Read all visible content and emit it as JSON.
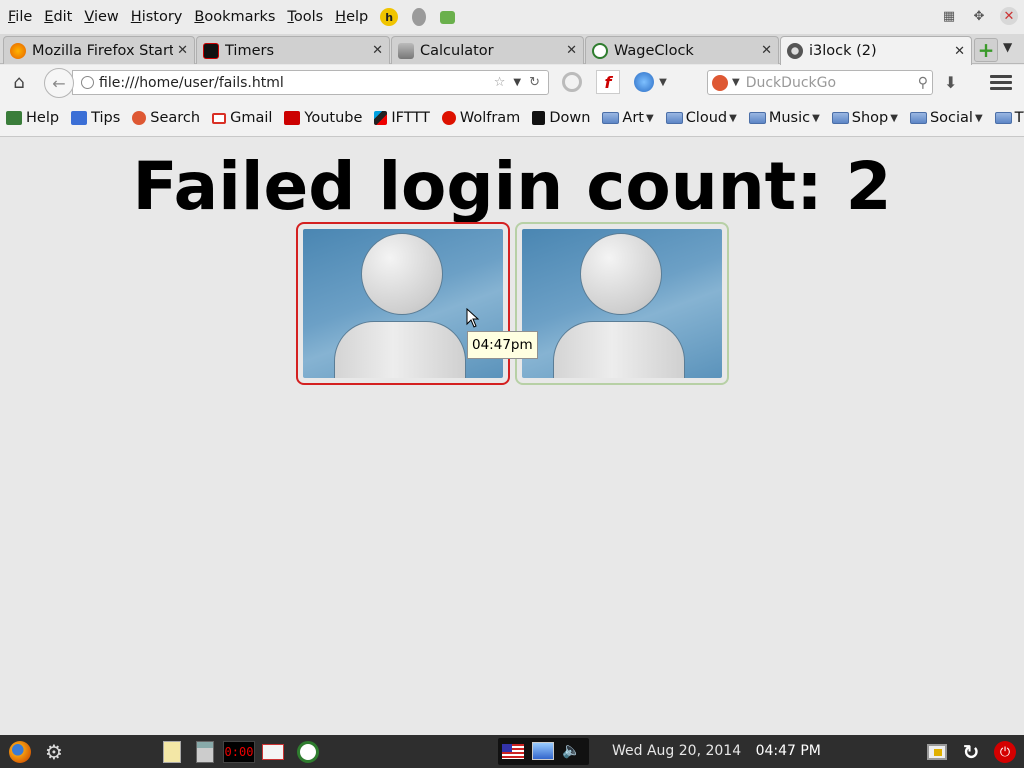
{
  "menubar": {
    "items": [
      "File",
      "Edit",
      "View",
      "History",
      "Bookmarks",
      "Tools",
      "Help"
    ]
  },
  "tabs": [
    {
      "label": "Mozilla Firefox Start ...",
      "close": "✕",
      "icon": "firefox-icon",
      "color": "#e66000"
    },
    {
      "label": "Timers",
      "close": "✕",
      "icon": "timer-icon",
      "color": "#cc0000"
    },
    {
      "label": "Calculator",
      "close": "✕",
      "icon": "calculator-icon",
      "color": "#7a7a7a"
    },
    {
      "label": "WageClock",
      "close": "✕",
      "icon": "wageclock-icon",
      "color": "#2f7d2f"
    },
    {
      "label": "i3lock (2)",
      "close": "✕",
      "icon": "i3lock-icon",
      "color": "#555555"
    }
  ],
  "navbar": {
    "url": "file:///home/user/fails.html",
    "search_placeholder": "DuckDuckGo"
  },
  "bookmarks": [
    {
      "label": "Help",
      "icon": "help-icon",
      "color": "#3a7d3a"
    },
    {
      "label": "Tips",
      "icon": "tips-icon",
      "color": "#3b6fd6"
    },
    {
      "label": "Search",
      "icon": "duckduckgo-icon",
      "color": "#de5833"
    },
    {
      "label": "Gmail",
      "icon": "gmail-icon",
      "color": "#d93025"
    },
    {
      "label": "Youtube",
      "icon": "youtube-icon",
      "color": "#cc0000"
    },
    {
      "label": "IFTTT",
      "icon": "ifttt-icon",
      "color": "#222222"
    },
    {
      "label": "Wolfram",
      "icon": "wolfram-icon",
      "color": "#dd1100"
    },
    {
      "label": "Down",
      "icon": "down-icon",
      "color": "#111111"
    }
  ],
  "bookmark_folders": [
    "Art",
    "Cloud",
    "Music",
    "Shop",
    "Social",
    "TV"
  ],
  "content": {
    "heading": "Failed login count: 2",
    "tooltip": "04:47pm",
    "tiles": [
      {
        "state": "failed",
        "border_color": "#d42020"
      },
      {
        "state": "normal",
        "border_color": "#b7d0a5"
      }
    ]
  },
  "taskbar": {
    "date": "Wed Aug 20, 2014",
    "time": "04:47 PM",
    "timer_display": "0:00"
  }
}
